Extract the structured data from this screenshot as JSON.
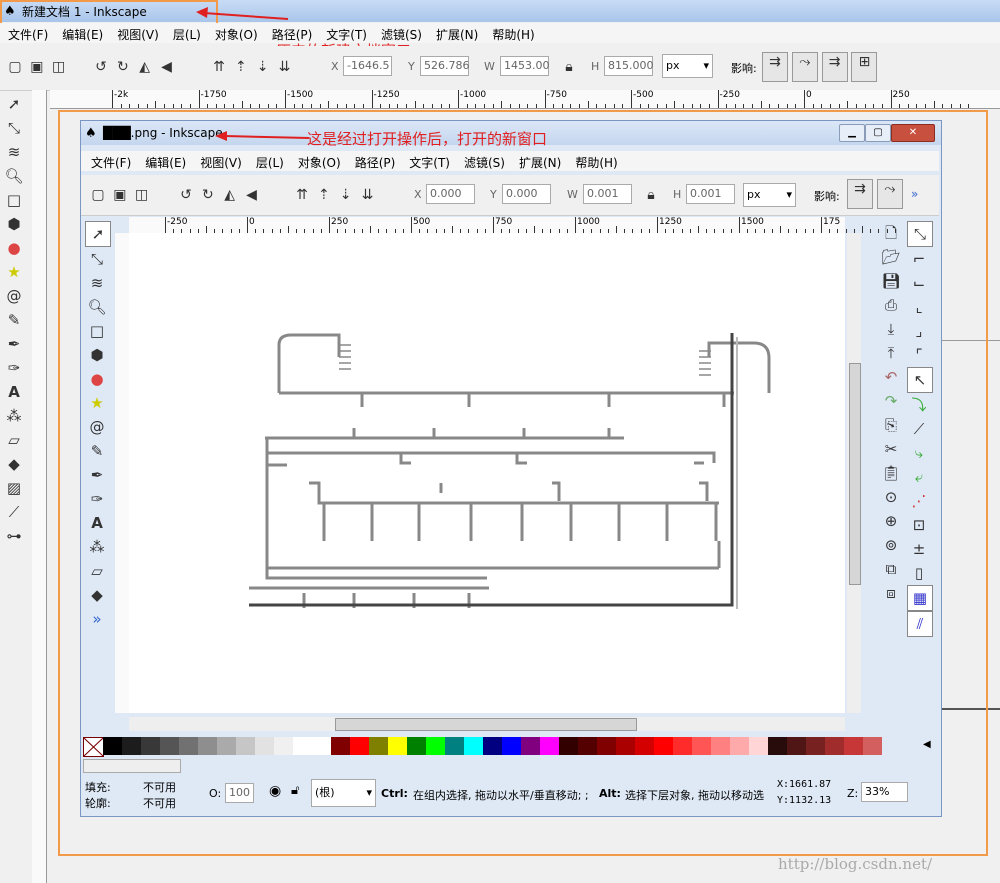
{
  "outer": {
    "title": "新建文档 1 - Inkscape",
    "menu": [
      "文件(F)",
      "编辑(E)",
      "视图(V)",
      "层(L)",
      "对象(O)",
      "路径(P)",
      "文字(T)",
      "滤镜(S)",
      "扩展(N)",
      "帮助(H)"
    ],
    "annotation": "原来的新建文档窗口",
    "toolbar": {
      "x_label": "X",
      "x_value": "-1646.5",
      "y_label": "Y",
      "y_value": "526.786",
      "w_label": "W",
      "w_value": "1453.00",
      "h_label": "H",
      "h_value": "815.000",
      "unit": "px",
      "affect_label": "影响:"
    },
    "ruler_labels": [
      "-2k",
      "-1750",
      "-1500",
      "-1250",
      "-1000",
      "-750",
      "-500",
      "-250",
      "0",
      "250"
    ]
  },
  "inner": {
    "title": "███.png - Inkscape",
    "annotation": "这是经过打开操作后，打开的新窗口",
    "menu": [
      "文件(F)",
      "编辑(E)",
      "视图(V)",
      "层(L)",
      "对象(O)",
      "路径(P)",
      "文字(T)",
      "滤镜(S)",
      "扩展(N)",
      "帮助(H)"
    ],
    "toolbar": {
      "x_label": "X",
      "x_value": "0.000",
      "y_label": "Y",
      "y_value": "0.000",
      "w_label": "W",
      "w_value": "0.001",
      "h_label": "H",
      "h_value": "0.001",
      "unit": "px",
      "affect_label": "影响:"
    },
    "ruler_labels": [
      "-250",
      "0",
      "250",
      "500",
      "750",
      "1000",
      "1250",
      "1500",
      "175"
    ],
    "status": {
      "fill_label": "填充:",
      "fill_value": "不可用",
      "stroke_label": "轮廓:",
      "stroke_value": "不可用",
      "opacity_label": "O:",
      "opacity_value": "100",
      "layer_value": "(根)",
      "hint_ctrl": "Ctrl:",
      "hint_text": "在组内选择, 拖动以水平/垂直移动; ; ",
      "hint_alt": "Alt:",
      "hint_text2": "选择下层对象, 拖动以移动选",
      "coord_x": "X:1661.87",
      "coord_y": "Y:1132.13",
      "zoom_label": "Z:",
      "zoom_value": "33%"
    }
  },
  "watermark": "http://blog.csdn.net/",
  "colors": {
    "accent": "#f39a4a",
    "annotation": "#e02020"
  }
}
